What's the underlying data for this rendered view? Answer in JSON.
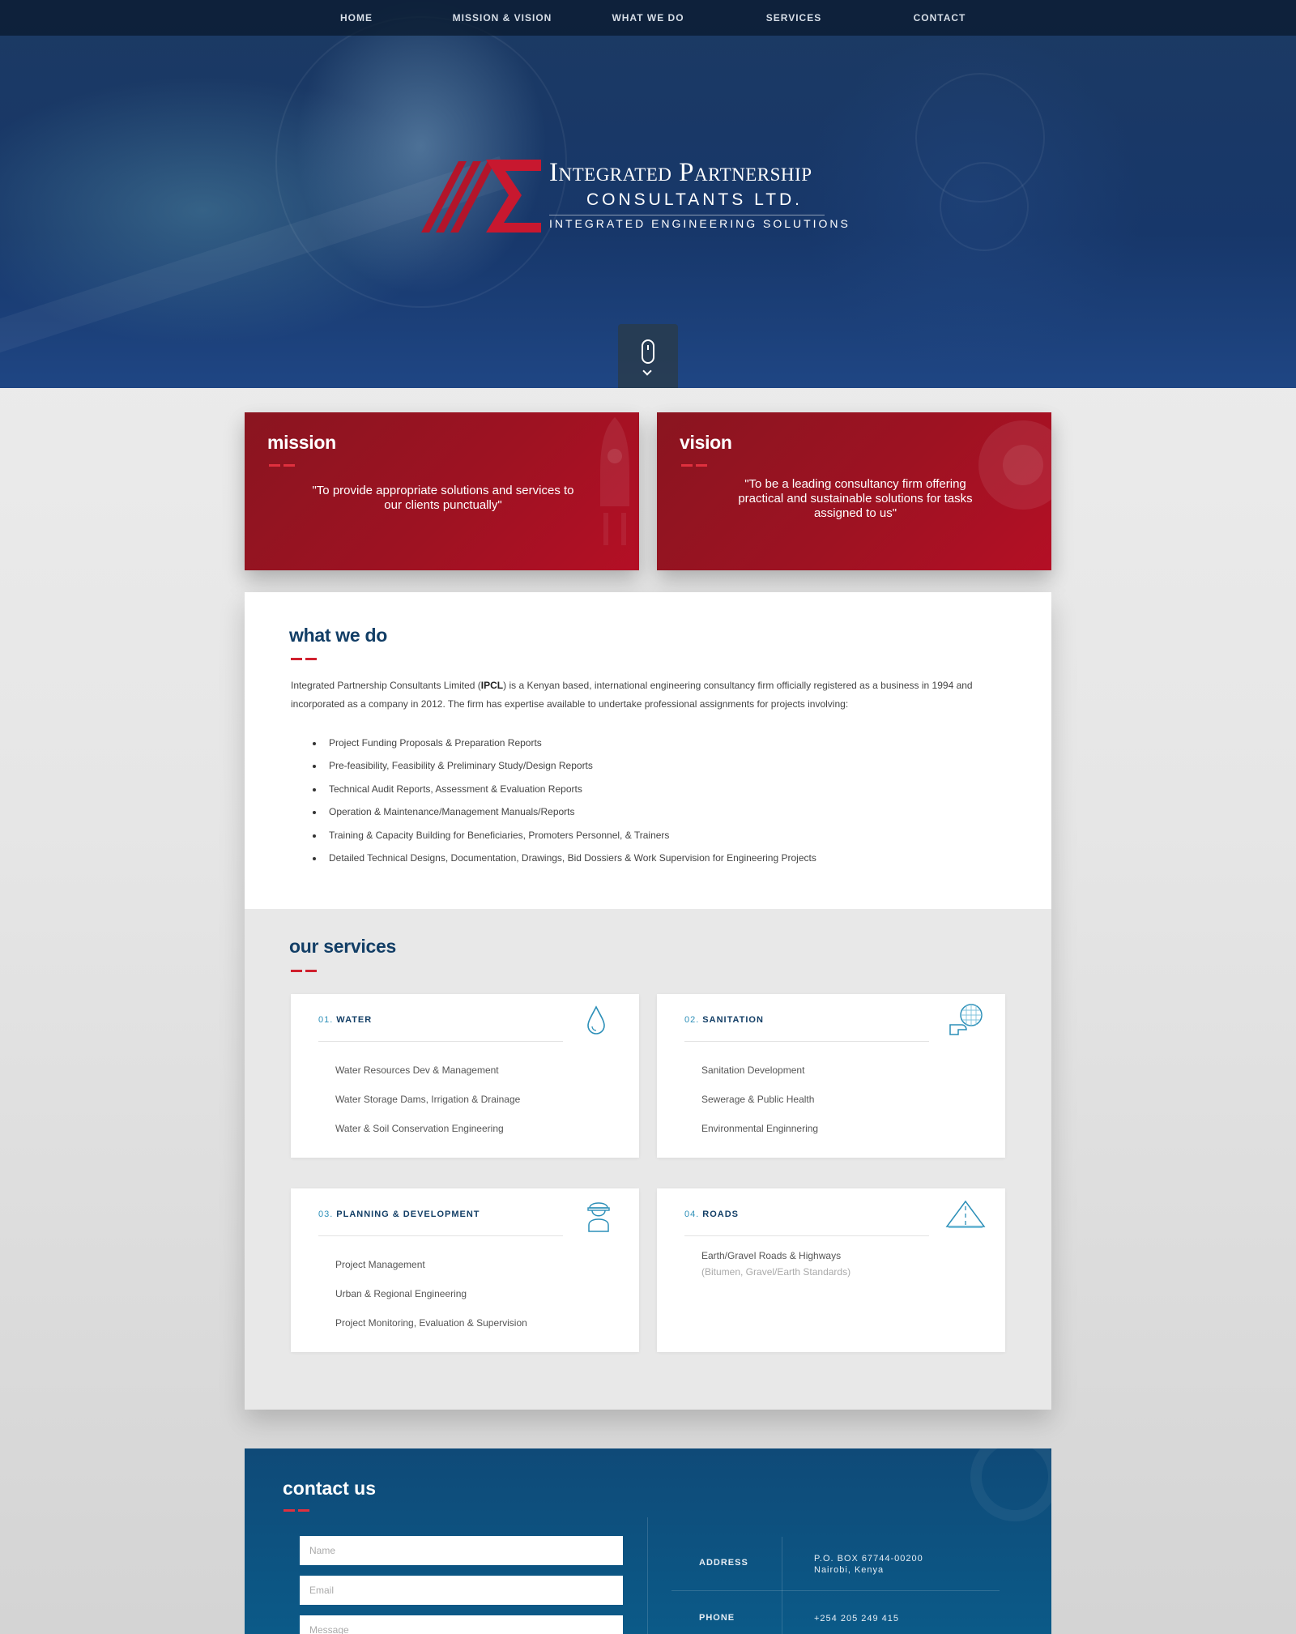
{
  "nav": {
    "items": [
      "HOME",
      "MISSION & VISION",
      "WHAT WE DO",
      "SERVICES",
      "CONTACT"
    ]
  },
  "hero": {
    "logo_line1": "Integrated Partnership",
    "logo_line2": "CONSULTANTS LTD.",
    "logo_line3": "INTEGRATED ENGINEERING SOLUTIONS",
    "scroll_icon": "mouse-scroll-icon"
  },
  "mission": {
    "title": "mission",
    "quote": "\"To provide appropriate solutions and services to our clients punctually\"",
    "icon": "rocket-icon"
  },
  "vision": {
    "title": "vision",
    "quote": "\"To be a leading consultancy firm offering practical and sustainable solutions for tasks assigned to us\"",
    "icon": "target-icon"
  },
  "what_we_do": {
    "title": "what we do",
    "intro_before": "Integrated Partnership Consultants Limited (",
    "intro_bold": "IPCL",
    "intro_after": ") is a Kenyan based, international engineering consultancy firm officially registered as a business in 1994 and incorporated as a company in 2012. The firm has expertise available to undertake professional assignments for projects involving:",
    "items": [
      "Project Funding Proposals & Preparation Reports",
      "Pre-feasibility, Feasibility & Preliminary Study/Design Reports",
      "Technical Audit Reports, Assessment & Evaluation Reports",
      "Operation & Maintenance/Management Manuals/Reports",
      "Training & Capacity Building for Beneficiaries, Promoters Personnel, & Trainers",
      "Detailed Technical Designs, Documentation, Drawings, Bid Dossiers & Work Supervision for Engineering Projects"
    ]
  },
  "services": {
    "title": "our services",
    "cards": [
      {
        "num": "01.",
        "name": "WATER",
        "icon": "water-drop-icon",
        "items": [
          "Water Resources Dev & Management",
          "Water Storage Dams, Irrigation & Drainage",
          "Water & Soil Conservation Engineering"
        ]
      },
      {
        "num": "02.",
        "name": "SANITATION",
        "icon": "sanitation-icon",
        "items": [
          "Sanitation Development",
          "Sewerage & Public Health",
          "Environmental Enginnering"
        ]
      },
      {
        "num": "03.",
        "name": "PLANNING & DEVELOPMENT",
        "icon": "engineer-icon",
        "items": [
          "Project Management",
          "Urban & Regional Engineering",
          "Project Monitoring, Evaluation & Supervision"
        ]
      },
      {
        "num": "04.",
        "name": "ROADS",
        "icon": "road-icon",
        "items": [
          "Earth/Gravel Roads & Highways"
        ],
        "sub": "(Bitumen, Gravel/Earth Standards)"
      }
    ]
  },
  "contact": {
    "title": "contact us",
    "name_placeholder": "Name",
    "email_placeholder": "Email",
    "message_placeholder": "Message",
    "address_label": "ADDRESS",
    "address_line1": "P.O. BOX 67744-00200",
    "address_line2": "Nairobi, Kenya",
    "phone_label": "PHONE",
    "phone_value": "+254 205 249 415",
    "icon": "phone-icon"
  },
  "colors": {
    "brand_red": "#9e1222",
    "brand_navy": "#123e66",
    "accent_teal": "#2c8fb8",
    "contact_blue": "#0f4a78"
  }
}
